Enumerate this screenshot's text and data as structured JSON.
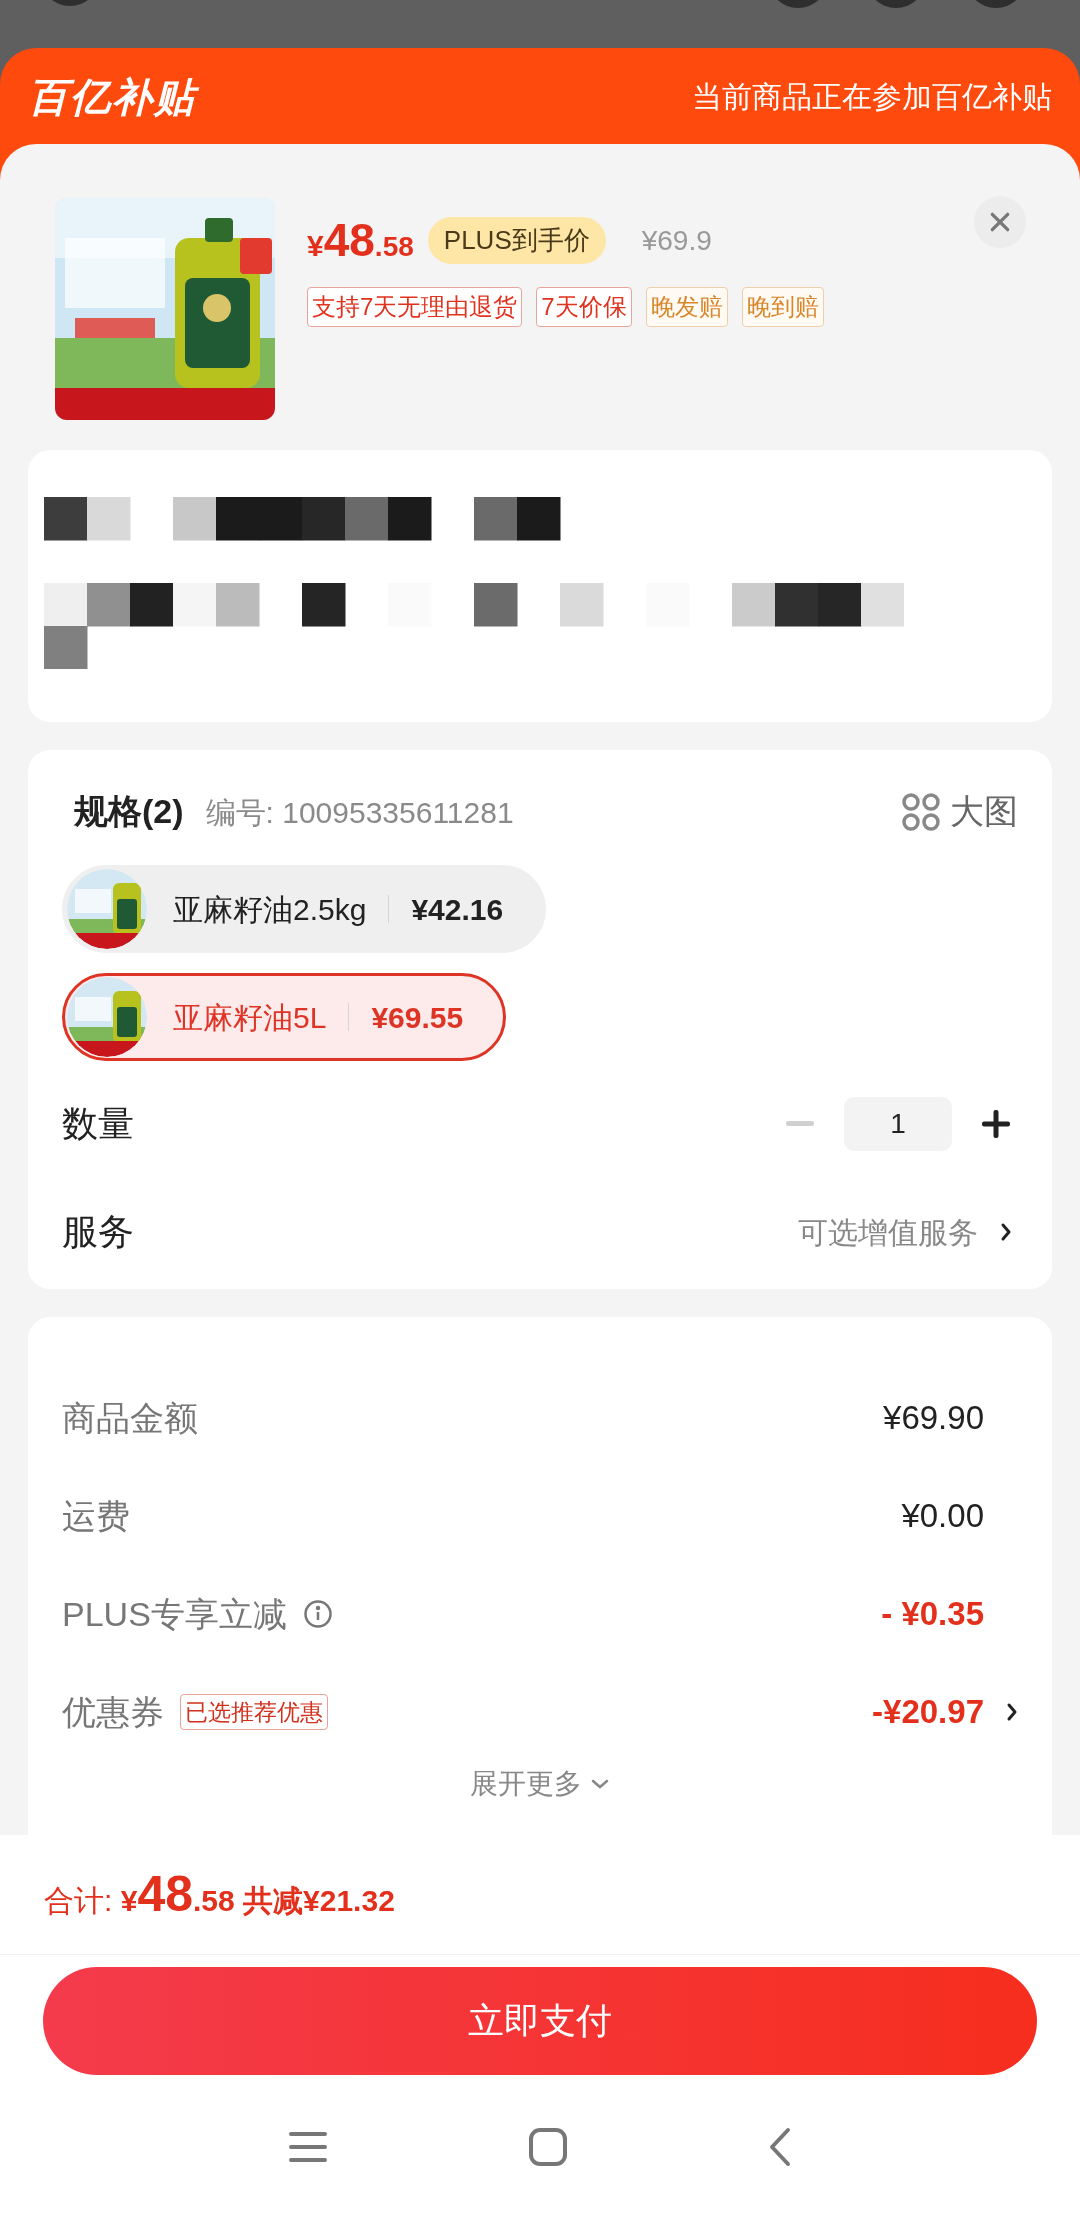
{
  "header": {
    "logo": "百亿补贴",
    "notice": "当前商品正在参加百亿补贴"
  },
  "product": {
    "price_symbol": "¥",
    "price_integer": "48",
    "price_decimal": ".58",
    "price_badge": "PLUS到手价",
    "original_price": "¥69.9",
    "tags": [
      {
        "label": "支持7天无理由退货",
        "kind": "red"
      },
      {
        "label": "7天价保",
        "kind": "red"
      },
      {
        "label": "晚发赔",
        "kind": "orange"
      },
      {
        "label": "晚到赔",
        "kind": "orange"
      }
    ]
  },
  "specs": {
    "title": "规格(2)",
    "code": "编号: 10095335611281",
    "big_image": "大图",
    "options": [
      {
        "name": "亚麻籽油2.5kg",
        "price": "¥42.16",
        "selected": false
      },
      {
        "name": "亚麻籽油5L",
        "price": "¥69.55",
        "selected": true
      }
    ]
  },
  "quantity": {
    "label": "数量",
    "value": "1",
    "decrease_disabled": true
  },
  "service": {
    "label": "服务",
    "value": "可选增值服务"
  },
  "summary": {
    "rows": [
      {
        "label": "商品金额",
        "value": "¥69.90",
        "kind": "plain",
        "info": false,
        "link": false
      },
      {
        "label": "运费",
        "value": "¥0.00",
        "kind": "plain",
        "info": false,
        "link": false
      },
      {
        "label": "PLUS专享立减",
        "value": "- ¥0.35",
        "kind": "discount",
        "info": true,
        "link": false
      },
      {
        "label": "优惠券",
        "value": "-¥20.97",
        "kind": "discount",
        "badge": "已选推荐优惠",
        "info": false,
        "link": true
      }
    ],
    "expand": "展开更多"
  },
  "footer": {
    "total_label": "合计:",
    "symbol": "¥",
    "integer": "48",
    "decimal": ".58",
    "saved": "共减¥21.32"
  },
  "pay_button": "立即支付"
}
